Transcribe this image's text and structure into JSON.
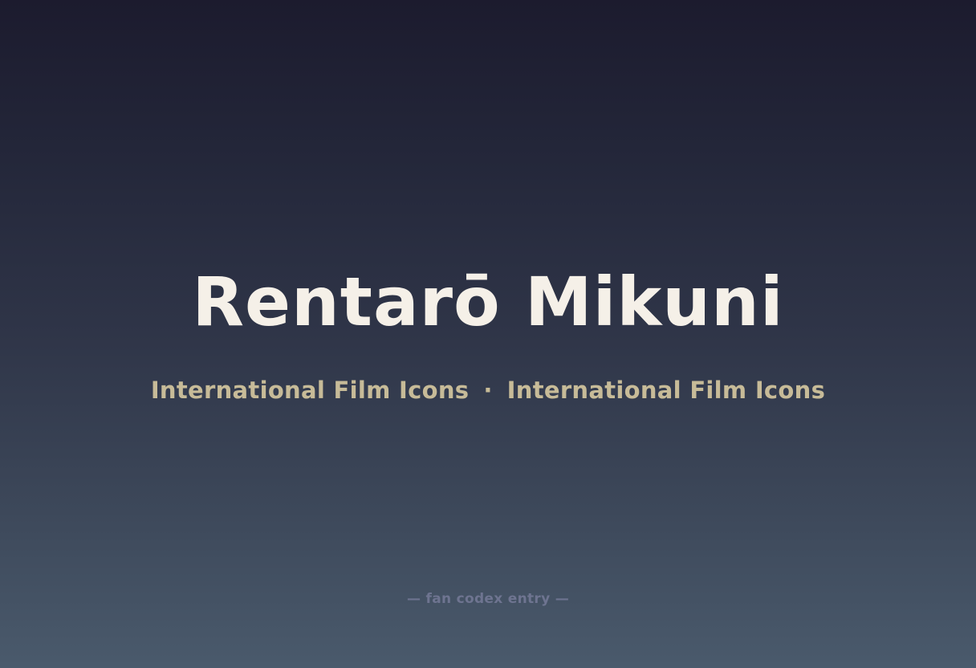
{
  "title": "Rentarō Mikuni",
  "subtitle": {
    "left": "International Film Icons",
    "separator": "·",
    "right": "International Film Icons"
  },
  "footer": "— fan codex entry —",
  "colors": {
    "title": "#f5f0e8",
    "subtitle": "#c7bb98",
    "footer": "#6e7490",
    "background_top": "#1c1b2e",
    "background_bottom": "#4a5a6c"
  }
}
